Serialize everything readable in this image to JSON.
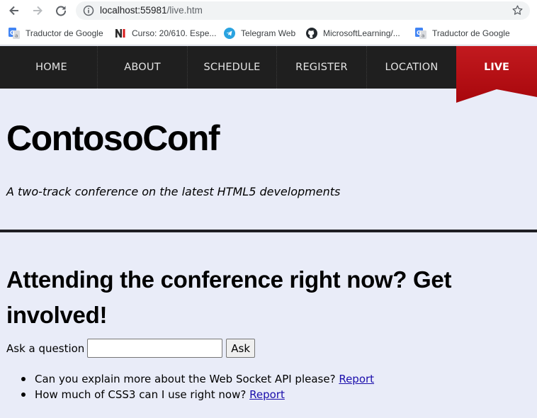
{
  "browser": {
    "url_host": "localhost:55981",
    "url_path": "/live.htm",
    "icons": [
      "back-icon",
      "forward-icon",
      "reload-icon",
      "info-icon",
      "star-icon"
    ]
  },
  "bookmarks": [
    {
      "label": "Traductor de Google",
      "icon": "google-translate-icon"
    },
    {
      "label": "Curso: 20/610. Espe...",
      "icon": "ni-icon"
    },
    {
      "label": "Telegram Web",
      "icon": "telegram-icon"
    },
    {
      "label": "MicrosoftLearning/...",
      "icon": "github-icon"
    },
    {
      "label": "Traductor de Google",
      "icon": "google-translate-icon"
    }
  ],
  "nav": {
    "items": [
      "HOME",
      "ABOUT",
      "SCHEDULE",
      "REGISTER",
      "LOCATION"
    ],
    "active": "LIVE",
    "active_color": "#a8070c"
  },
  "header": {
    "title": "ContosoConf",
    "tagline": "A two-track conference on the latest HTML5 developments"
  },
  "live": {
    "heading": "Attending the conference right now? Get involved!",
    "ask_label": "Ask a question",
    "ask_value": "",
    "ask_button": "Ask",
    "questions": [
      {
        "text": "Can you explain more about the Web Socket API please?",
        "report": "Report"
      },
      {
        "text": "How much of CSS3 can I use right now?",
        "report": "Report"
      }
    ]
  }
}
